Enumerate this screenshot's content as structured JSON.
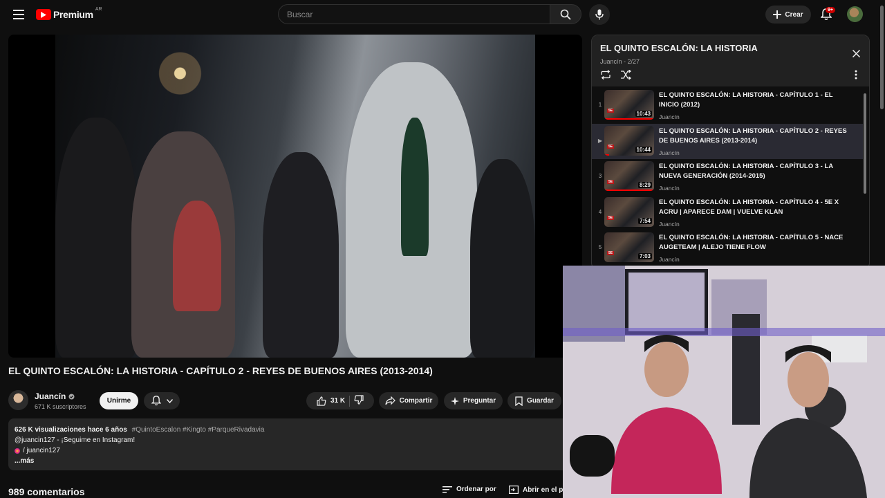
{
  "header": {
    "logo_text": "Premium",
    "country": "AR",
    "search_placeholder": "Buscar",
    "create_label": "Crear",
    "notif_badge": "9+"
  },
  "video": {
    "title": "EL QUINTO ESCALÓN: LA HISTORIA - CAPÍTULO 2 - REYES DE BUENOS AIRES (2013-2014)",
    "channel": "Juancín",
    "subscribers": "671 K suscriptores",
    "join_label": "Unirme",
    "likes": "31 K",
    "share_label": "Compartir",
    "ask_label": "Preguntar",
    "save_label": "Guardar"
  },
  "description": {
    "stats": "626 K visualizaciones  hace 6 años",
    "tags": "#QuintoEscalon #Kingto #ParqueRivadavia",
    "line1": "@juancin127 - ¡Seguime en Instagram!",
    "line2": "/ juancin127",
    "more": "...más"
  },
  "comments": {
    "count": "989 comentarios",
    "sort_label": "Ordenar por",
    "open_label": "Abrir en el pa"
  },
  "playlist": {
    "title": "EL QUINTO ESCALÓN: LA HISTORIA",
    "channel": "Juancín",
    "position": "2/27",
    "items": [
      {
        "index": "1",
        "title": "EL QUINTO ESCALÓN: LA HISTORIA - CAPÍTULO 1 - EL INICIO (2012)",
        "channel": "Juancín",
        "duration": "10:43",
        "progress": 1.0
      },
      {
        "index": "▶",
        "title": "EL QUINTO ESCALÓN: LA HISTORIA - CAPÍTULO 2 - REYES DE BUENOS AIRES (2013-2014)",
        "channel": "Juancín",
        "duration": "10:44",
        "progress": 0.1
      },
      {
        "index": "3",
        "title": "EL QUINTO ESCALÓN: LA HISTORIA - CAPÍTULO 3 - LA NUEVA GENERACIÓN (2014-2015)",
        "channel": "Juancín",
        "duration": "8:29",
        "progress": 1.0
      },
      {
        "index": "4",
        "title": "EL QUINTO ESCALÓN: LA HISTORIA - CAPÍTULO 4 - 5E X ACRU | APARECE DAM | VUELVE KLAN",
        "channel": "Juancín",
        "duration": "7:54",
        "progress": 0.0
      },
      {
        "index": "5",
        "title": "EL QUINTO ESCALÓN: LA HISTORIA - CAPÍTULO 5 - NACE AUGETEAM | ALEJO TIENE FLOW",
        "channel": "Juancín",
        "duration": "7:03",
        "progress": 0.0
      }
    ]
  }
}
